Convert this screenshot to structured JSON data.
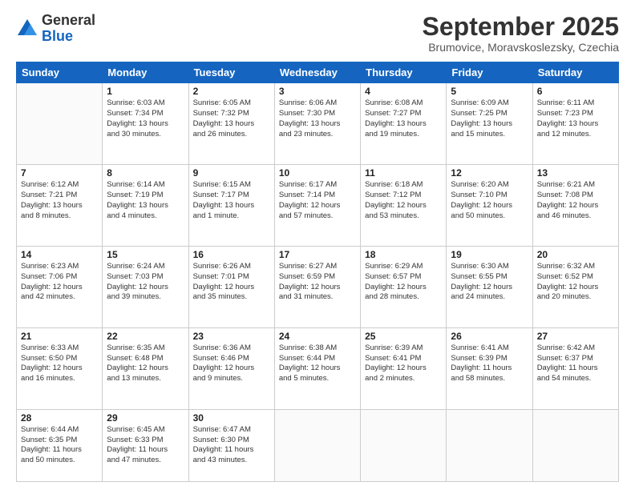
{
  "header": {
    "logo": {
      "general": "General",
      "blue": "Blue"
    },
    "title": "September 2025",
    "location": "Brumovice, Moravskoslezsky, Czechia"
  },
  "weekdays": [
    "Sunday",
    "Monday",
    "Tuesday",
    "Wednesday",
    "Thursday",
    "Friday",
    "Saturday"
  ],
  "weeks": [
    [
      {
        "day": "",
        "content": ""
      },
      {
        "day": "1",
        "content": "Sunrise: 6:03 AM\nSunset: 7:34 PM\nDaylight: 13 hours\nand 30 minutes."
      },
      {
        "day": "2",
        "content": "Sunrise: 6:05 AM\nSunset: 7:32 PM\nDaylight: 13 hours\nand 26 minutes."
      },
      {
        "day": "3",
        "content": "Sunrise: 6:06 AM\nSunset: 7:30 PM\nDaylight: 13 hours\nand 23 minutes."
      },
      {
        "day": "4",
        "content": "Sunrise: 6:08 AM\nSunset: 7:27 PM\nDaylight: 13 hours\nand 19 minutes."
      },
      {
        "day": "5",
        "content": "Sunrise: 6:09 AM\nSunset: 7:25 PM\nDaylight: 13 hours\nand 15 minutes."
      },
      {
        "day": "6",
        "content": "Sunrise: 6:11 AM\nSunset: 7:23 PM\nDaylight: 13 hours\nand 12 minutes."
      }
    ],
    [
      {
        "day": "7",
        "content": "Sunrise: 6:12 AM\nSunset: 7:21 PM\nDaylight: 13 hours\nand 8 minutes."
      },
      {
        "day": "8",
        "content": "Sunrise: 6:14 AM\nSunset: 7:19 PM\nDaylight: 13 hours\nand 4 minutes."
      },
      {
        "day": "9",
        "content": "Sunrise: 6:15 AM\nSunset: 7:17 PM\nDaylight: 13 hours\nand 1 minute."
      },
      {
        "day": "10",
        "content": "Sunrise: 6:17 AM\nSunset: 7:14 PM\nDaylight: 12 hours\nand 57 minutes."
      },
      {
        "day": "11",
        "content": "Sunrise: 6:18 AM\nSunset: 7:12 PM\nDaylight: 12 hours\nand 53 minutes."
      },
      {
        "day": "12",
        "content": "Sunrise: 6:20 AM\nSunset: 7:10 PM\nDaylight: 12 hours\nand 50 minutes."
      },
      {
        "day": "13",
        "content": "Sunrise: 6:21 AM\nSunset: 7:08 PM\nDaylight: 12 hours\nand 46 minutes."
      }
    ],
    [
      {
        "day": "14",
        "content": "Sunrise: 6:23 AM\nSunset: 7:06 PM\nDaylight: 12 hours\nand 42 minutes."
      },
      {
        "day": "15",
        "content": "Sunrise: 6:24 AM\nSunset: 7:03 PM\nDaylight: 12 hours\nand 39 minutes."
      },
      {
        "day": "16",
        "content": "Sunrise: 6:26 AM\nSunset: 7:01 PM\nDaylight: 12 hours\nand 35 minutes."
      },
      {
        "day": "17",
        "content": "Sunrise: 6:27 AM\nSunset: 6:59 PM\nDaylight: 12 hours\nand 31 minutes."
      },
      {
        "day": "18",
        "content": "Sunrise: 6:29 AM\nSunset: 6:57 PM\nDaylight: 12 hours\nand 28 minutes."
      },
      {
        "day": "19",
        "content": "Sunrise: 6:30 AM\nSunset: 6:55 PM\nDaylight: 12 hours\nand 24 minutes."
      },
      {
        "day": "20",
        "content": "Sunrise: 6:32 AM\nSunset: 6:52 PM\nDaylight: 12 hours\nand 20 minutes."
      }
    ],
    [
      {
        "day": "21",
        "content": "Sunrise: 6:33 AM\nSunset: 6:50 PM\nDaylight: 12 hours\nand 16 minutes."
      },
      {
        "day": "22",
        "content": "Sunrise: 6:35 AM\nSunset: 6:48 PM\nDaylight: 12 hours\nand 13 minutes."
      },
      {
        "day": "23",
        "content": "Sunrise: 6:36 AM\nSunset: 6:46 PM\nDaylight: 12 hours\nand 9 minutes."
      },
      {
        "day": "24",
        "content": "Sunrise: 6:38 AM\nSunset: 6:44 PM\nDaylight: 12 hours\nand 5 minutes."
      },
      {
        "day": "25",
        "content": "Sunrise: 6:39 AM\nSunset: 6:41 PM\nDaylight: 12 hours\nand 2 minutes."
      },
      {
        "day": "26",
        "content": "Sunrise: 6:41 AM\nSunset: 6:39 PM\nDaylight: 11 hours\nand 58 minutes."
      },
      {
        "day": "27",
        "content": "Sunrise: 6:42 AM\nSunset: 6:37 PM\nDaylight: 11 hours\nand 54 minutes."
      }
    ],
    [
      {
        "day": "28",
        "content": "Sunrise: 6:44 AM\nSunset: 6:35 PM\nDaylight: 11 hours\nand 50 minutes."
      },
      {
        "day": "29",
        "content": "Sunrise: 6:45 AM\nSunset: 6:33 PM\nDaylight: 11 hours\nand 47 minutes."
      },
      {
        "day": "30",
        "content": "Sunrise: 6:47 AM\nSunset: 6:30 PM\nDaylight: 11 hours\nand 43 minutes."
      },
      {
        "day": "",
        "content": ""
      },
      {
        "day": "",
        "content": ""
      },
      {
        "day": "",
        "content": ""
      },
      {
        "day": "",
        "content": ""
      }
    ]
  ]
}
